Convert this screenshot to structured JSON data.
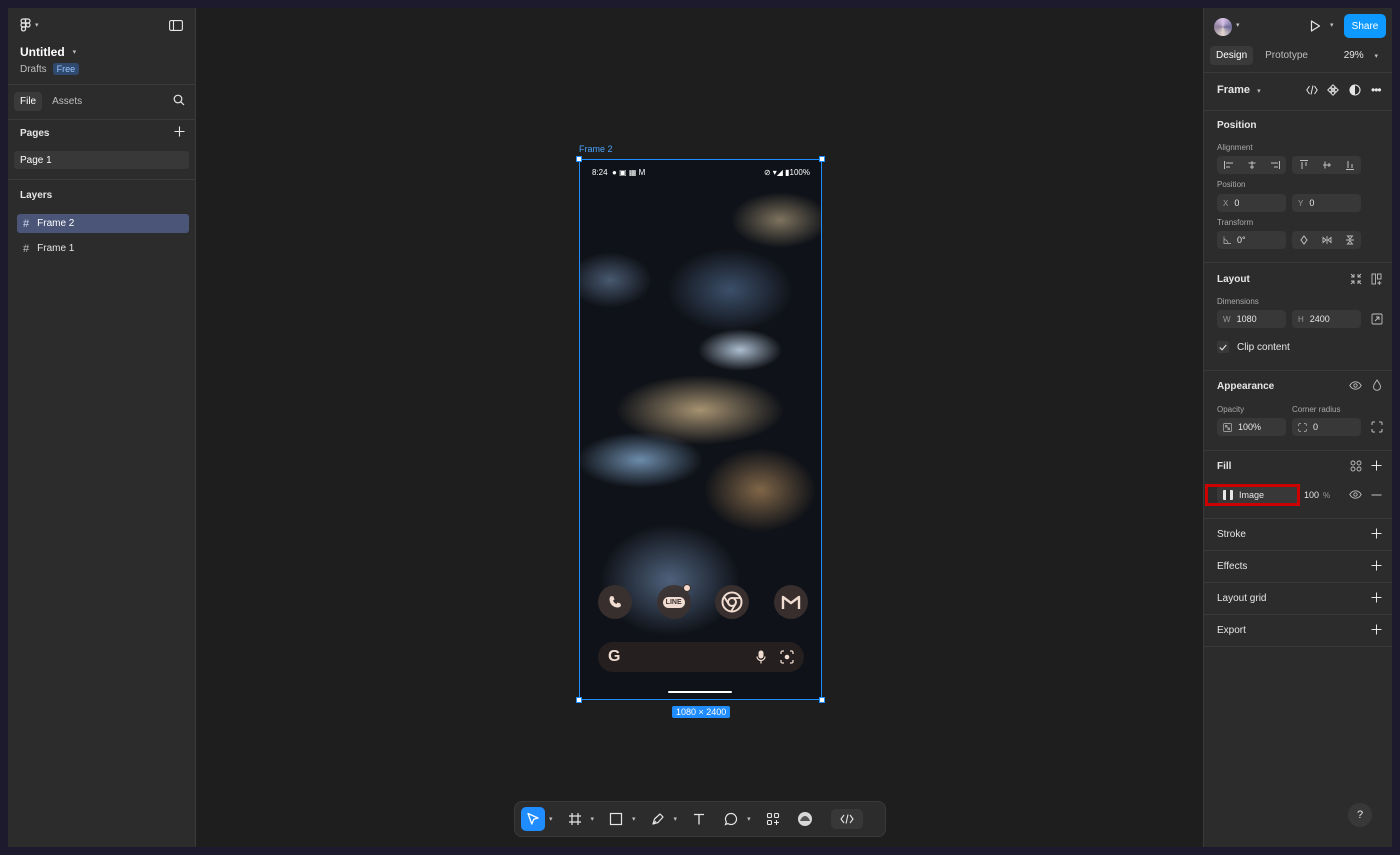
{
  "left_panel": {
    "file_title": "Untitled",
    "drafts_label": "Drafts",
    "plan_badge": "Free",
    "tabs": [
      "File",
      "Assets"
    ],
    "pages_label": "Pages",
    "pages": [
      "Page 1"
    ],
    "layers_label": "Layers",
    "layers": [
      "Frame 2",
      "Frame 1"
    ]
  },
  "canvas": {
    "frame_label": "Frame 2",
    "dimensions_badge": "1080 × 2400",
    "phone": {
      "time": "8:24",
      "battery": "100%",
      "dock_apps": [
        "phone-icon",
        "LINE",
        "chrome-icon",
        "gmail-icon"
      ],
      "search_logo": "G"
    }
  },
  "right_panel": {
    "share_label": "Share",
    "tabs": [
      "Design",
      "Prototype"
    ],
    "zoom": "29%",
    "selection_type": "Frame",
    "position_section": "Position",
    "alignment_label": "Alignment",
    "position_label": "Position",
    "x_value": "0",
    "y_value": "0",
    "transform_label": "Transform",
    "rotation": "0°",
    "layout_section": "Layout",
    "dimensions_label": "Dimensions",
    "width": "1080",
    "height": "2400",
    "clip_content_label": "Clip content",
    "appearance_section": "Appearance",
    "opacity_label": "Opacity",
    "opacity_value": "100%",
    "corner_radius_label": "Corner radius",
    "corner_radius_value": "0",
    "fill_section": "Fill",
    "fill_type": "Image",
    "fill_opacity": "100",
    "fill_opacity_unit": "%",
    "stroke_section": "Stroke",
    "effects_section": "Effects",
    "layout_grid_section": "Layout grid",
    "export_section": "Export",
    "help": "?"
  },
  "colors": {
    "accent": "#0d99ff",
    "selection": "#1f8cff",
    "highlight": "#cc0000"
  }
}
